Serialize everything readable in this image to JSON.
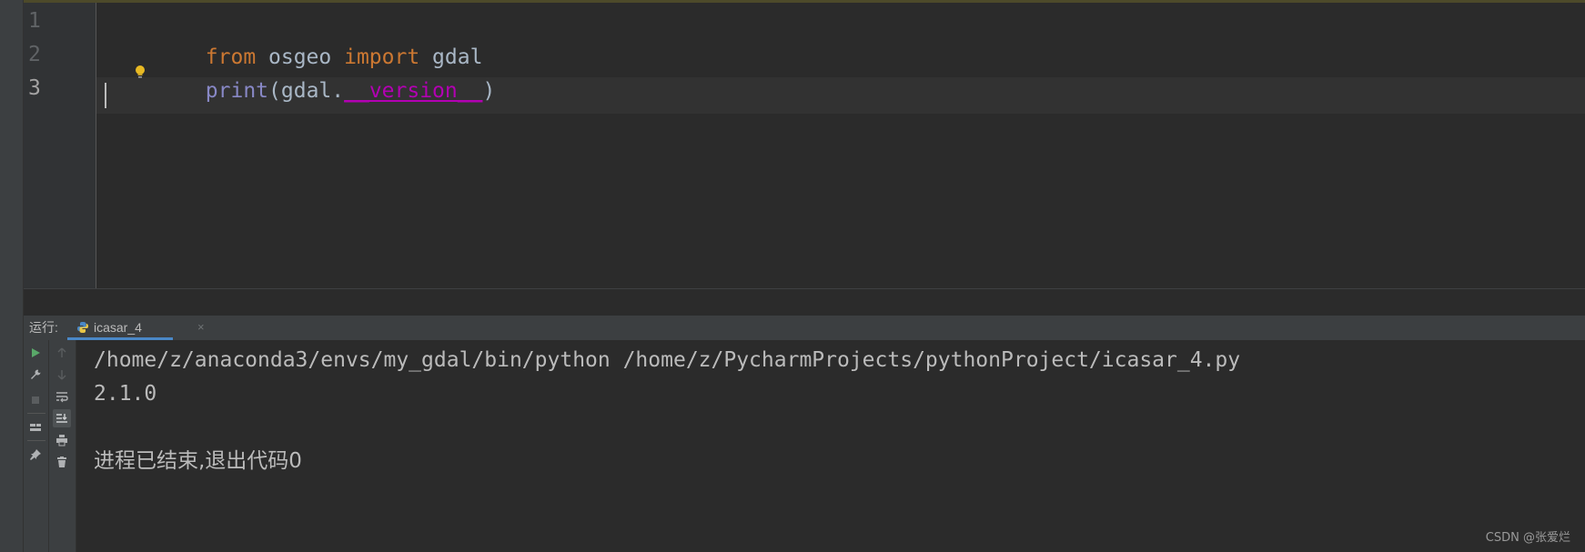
{
  "editor": {
    "line_numbers": [
      "1",
      "2",
      "3"
    ],
    "lines": [
      {
        "tokens": [
          {
            "text": "from",
            "kind": "keyword"
          },
          {
            "text": " osgeo ",
            "kind": "plain"
          },
          {
            "text": "import",
            "kind": "keyword"
          },
          {
            "text": " gdal",
            "kind": "plain"
          }
        ]
      },
      {
        "tokens": [
          {
            "text": "print",
            "kind": "builtin"
          },
          {
            "text": "(gdal.",
            "kind": "plain"
          },
          {
            "text": "__version__",
            "kind": "dunder"
          },
          {
            "text": ")",
            "kind": "plain"
          }
        ]
      }
    ]
  },
  "run_panel": {
    "label": "运行:",
    "tab": {
      "name": "icasar_4",
      "close": "×",
      "icon": "python-file-icon"
    },
    "toolbar_left": [
      "run-icon",
      "wrench-icon",
      "stop-icon",
      "layout-icon",
      "pin-icon"
    ],
    "toolbar_right": [
      "up-arrow-icon",
      "down-arrow-icon",
      "soft-wrap-icon",
      "scroll-to-end-icon",
      "print-icon",
      "trash-icon"
    ],
    "output": [
      "/home/z/anaconda3/envs/my_gdal/bin/python /home/z/PycharmProjects/pythonProject/icasar_4.py",
      "2.1.0",
      "",
      "进程已结束,退出代码0"
    ]
  },
  "watermark": "CSDN @张爱烂",
  "colors": {
    "keyword": "#cc7832",
    "builtin": "#8888c6",
    "dunder": "#b200b2",
    "plain": "#a9b7c6",
    "background": "#2b2b2b",
    "run_icon": "#59a869"
  }
}
